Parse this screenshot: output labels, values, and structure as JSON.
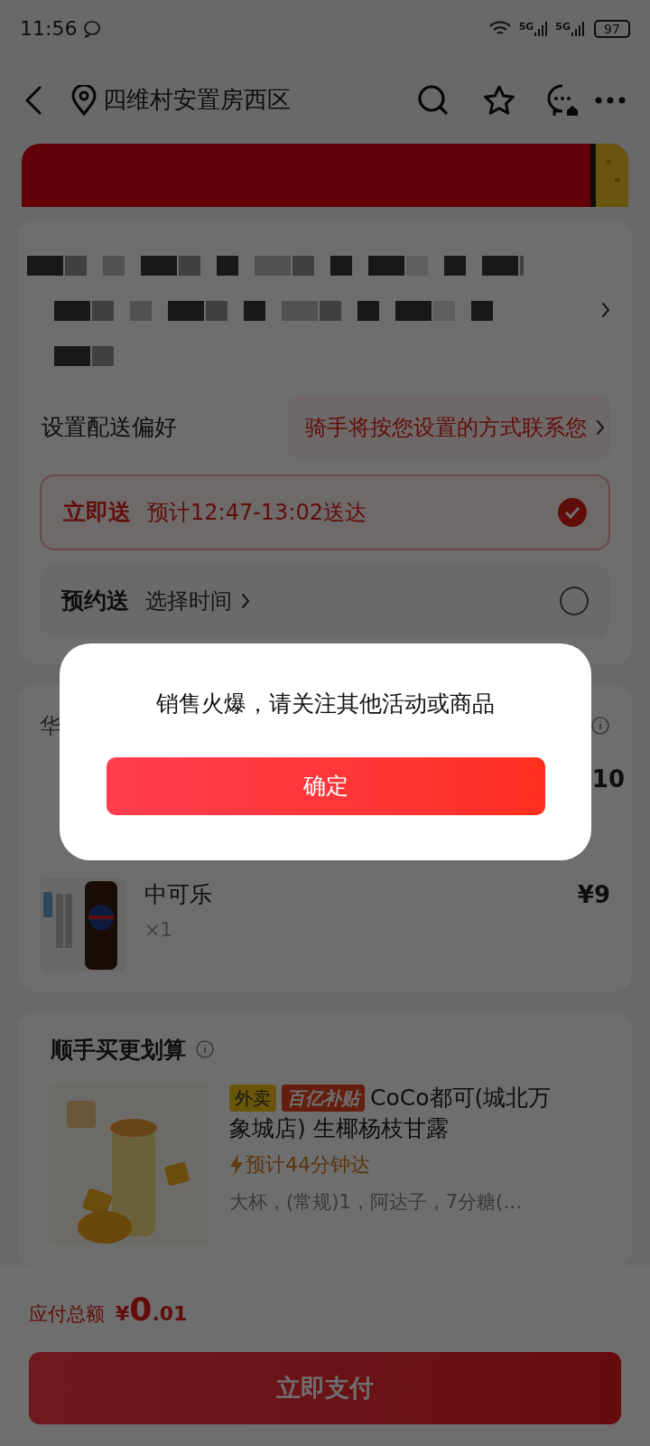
{
  "status_bar": {
    "time": "11:56",
    "network": [
      "5G",
      "5G"
    ],
    "battery": "97"
  },
  "nav": {
    "location": "四维村安置房西区"
  },
  "delivery_preference": {
    "label": "设置配送偏好",
    "hint": "骑手将按您设置的方式联系您"
  },
  "delivery_options": [
    {
      "label": "立即送",
      "detail": "预计12:47-13:02送达",
      "selected": true
    },
    {
      "label": "预约送",
      "detail": "选择时间",
      "selected": false
    }
  ],
  "order": {
    "section_title": "华",
    "items": [
      {
        "price": "10"
      },
      {
        "name": "中可乐",
        "quantity": "×1",
        "price": "¥9"
      }
    ]
  },
  "recommend": {
    "title": "顺手买更划算",
    "product": {
      "tags": [
        {
          "label": "外卖",
          "color": "#69550a"
        },
        {
          "label": "百亿补贴",
          "color": "#641d0d"
        }
      ],
      "name_lines": [
        "CoCo都可(城北万",
        "象城店) 生椰杨枝甘露"
      ],
      "eta": "预计44分钟达",
      "spec": "大杯，(常规)1，阿达子，7分糖(…"
    }
  },
  "footer": {
    "total_label": "应付总额",
    "currency": "¥",
    "amount": "0",
    "amount_decimal": ".01",
    "pay_button": "立即支付"
  },
  "dialog": {
    "message": "销售火爆，请关注其他活动或商品",
    "confirm": "确定"
  }
}
